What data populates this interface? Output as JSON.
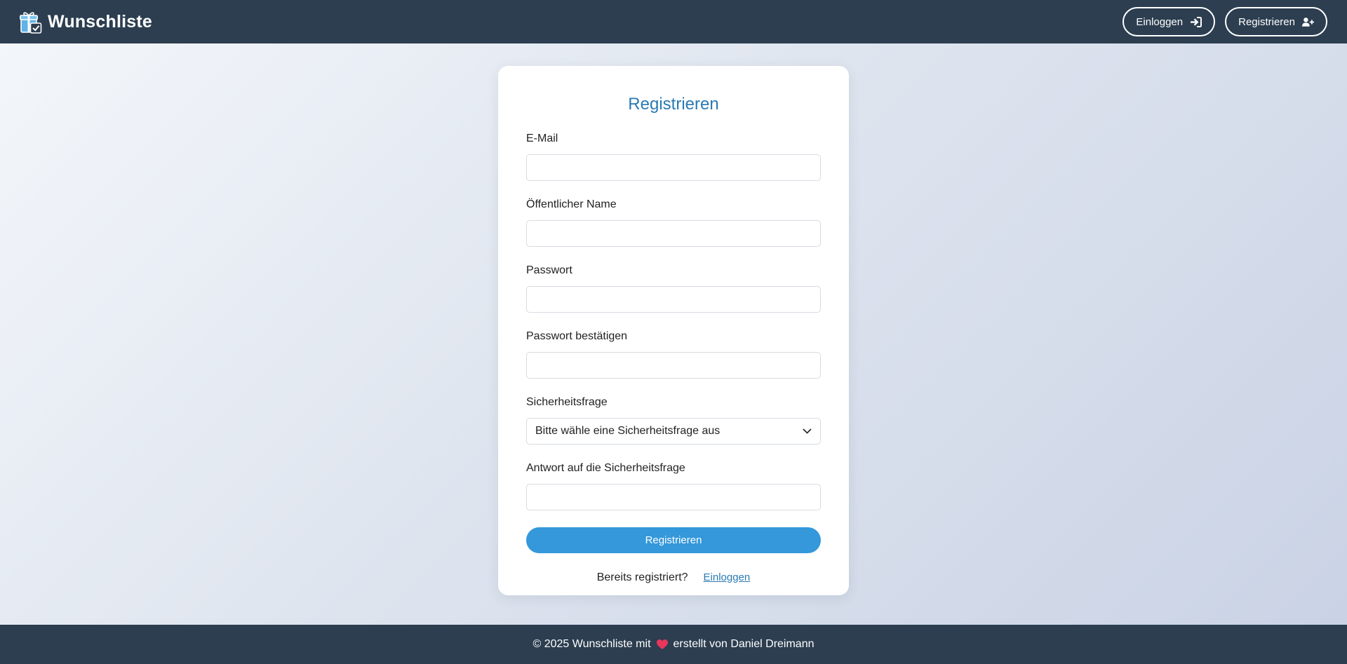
{
  "brand": {
    "name": "Wunschliste",
    "icon": "gift-icon"
  },
  "nav": {
    "login_label": "Einloggen",
    "login_icon": "sign-in-icon",
    "register_label": "Registrieren",
    "register_icon": "user-plus-icon"
  },
  "form": {
    "title": "Registrieren",
    "email_label": "E-Mail",
    "email_value": "",
    "public_name_label": "Öffentlicher Name",
    "public_name_value": "",
    "password_label": "Passwort",
    "password_value": "",
    "password_confirm_label": "Passwort bestätigen",
    "password_confirm_value": "",
    "security_question_label": "Sicherheitsfrage",
    "security_question_selected": "Bitte wähle eine Sicherheitsfrage aus",
    "security_answer_label": "Antwort auf die Sicherheitsfrage",
    "security_answer_value": "",
    "submit_label": "Registrieren",
    "already_registered_text": "Bereits registriert?",
    "login_link_label": "Einloggen"
  },
  "footer": {
    "text_before": "© 2025 Wunschliste mit",
    "heart_icon": "heart-icon",
    "text_after": "erstellt von Daniel Dreimann"
  },
  "colors": {
    "navbar": "#2c3e50",
    "accent": "#3498db",
    "title": "#2a7ab3",
    "heart": "#e8365d"
  }
}
